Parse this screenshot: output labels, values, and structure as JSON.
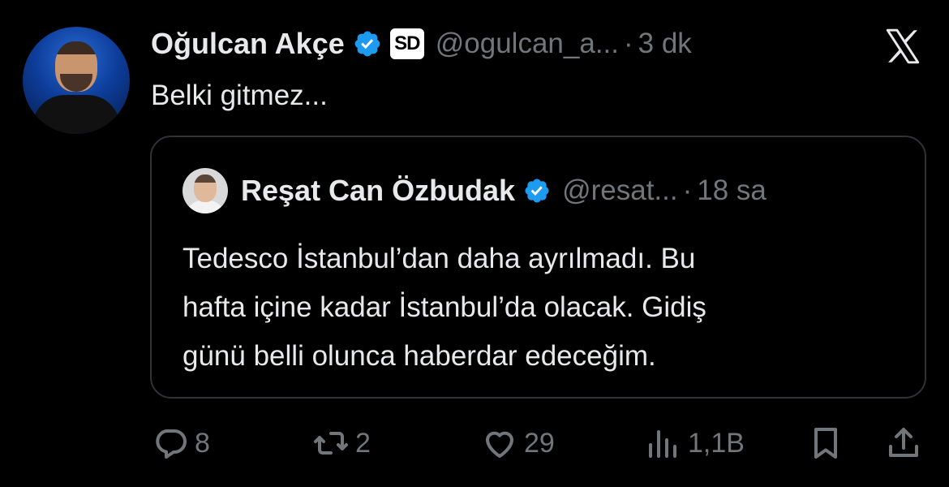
{
  "author": {
    "name": "Oğulcan Akçe",
    "badge_text": "SD",
    "handle": "@ogulcan_a...",
    "separator": "·",
    "time": "3 dk"
  },
  "tweet": {
    "text": "Belki gitmez..."
  },
  "quoted": {
    "name": "Reşat Can Özbudak",
    "handle": "@resat...",
    "separator": "·",
    "time": "18 sa",
    "lines": [
      "Tedesco İstanbul’dan daha ayrılmadı. Bu",
      "hafta içine kadar İstanbul’da olacak. Gidiş",
      "günü belli olunca haberdar edeceğim."
    ]
  },
  "actions": {
    "replies": "8",
    "reposts": "2",
    "likes": "29",
    "views": "1,1B"
  },
  "icons": {
    "verified": "verified-badge-icon",
    "x_logo": "x-logo-icon",
    "reply": "reply-icon",
    "repost": "repost-icon",
    "like": "heart-icon",
    "views": "views-icon",
    "bookmark": "bookmark-icon",
    "share": "share-icon"
  },
  "colors": {
    "background": "#000000",
    "text": "#e7e9ea",
    "secondary_text": "#71767b",
    "verified": "#1d9bf0",
    "border": "#2f3336"
  }
}
